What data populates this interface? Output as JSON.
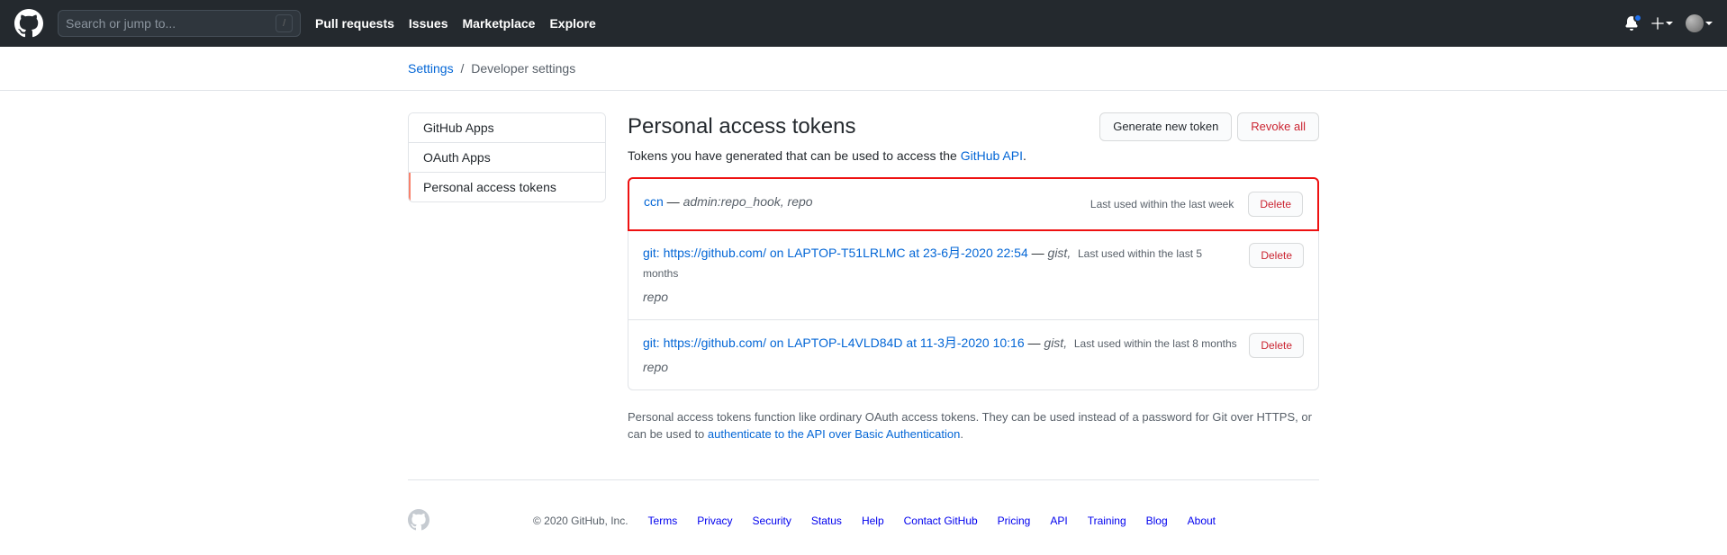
{
  "header": {
    "search_placeholder": "Search or jump to...",
    "nav": [
      "Pull requests",
      "Issues",
      "Marketplace",
      "Explore"
    ]
  },
  "breadcrumb": {
    "root": "Settings",
    "sep": "/",
    "current": "Developer settings"
  },
  "sidenav": {
    "items": [
      "GitHub Apps",
      "OAuth Apps",
      "Personal access tokens"
    ]
  },
  "page": {
    "title": "Personal access tokens",
    "generate_btn": "Generate new token",
    "revoke_btn": "Revoke all",
    "subtitle_pre": "Tokens you have generated that can be used to access the ",
    "subtitle_link": "GitHub API",
    "subtitle_post": "."
  },
  "tokens": [
    {
      "name": "ccn",
      "dash": " — ",
      "scopes": "admin:repo_hook, repo",
      "last_used": "Last used within the last week",
      "delete": "Delete"
    },
    {
      "name": "git: https://github.com/ on LAPTOP-T51LRLMC at 23-6月-2020 22:54",
      "dash": " — ",
      "scopes_inline": "gist,",
      "last_used": "Last used within the last 5 months",
      "scopes_below": "repo",
      "delete": "Delete"
    },
    {
      "name": "git: https://github.com/ on LAPTOP-L4VLD84D at 11-3月-2020 10:16",
      "dash": " — ",
      "scopes_inline": "gist,",
      "last_used": "Last used within the last 8 months",
      "scopes_below": "repo",
      "delete": "Delete"
    }
  ],
  "note": {
    "pre": "Personal access tokens function like ordinary OAuth access tokens. They can be used instead of a password for Git over HTTPS, or can be used to ",
    "link": "authenticate to the API over Basic Authentication",
    "post": "."
  },
  "footer": {
    "copyright": "© 2020 GitHub, Inc.",
    "links": [
      "Terms",
      "Privacy",
      "Security",
      "Status",
      "Help",
      "Contact GitHub",
      "Pricing",
      "API",
      "Training",
      "Blog",
      "About"
    ]
  }
}
